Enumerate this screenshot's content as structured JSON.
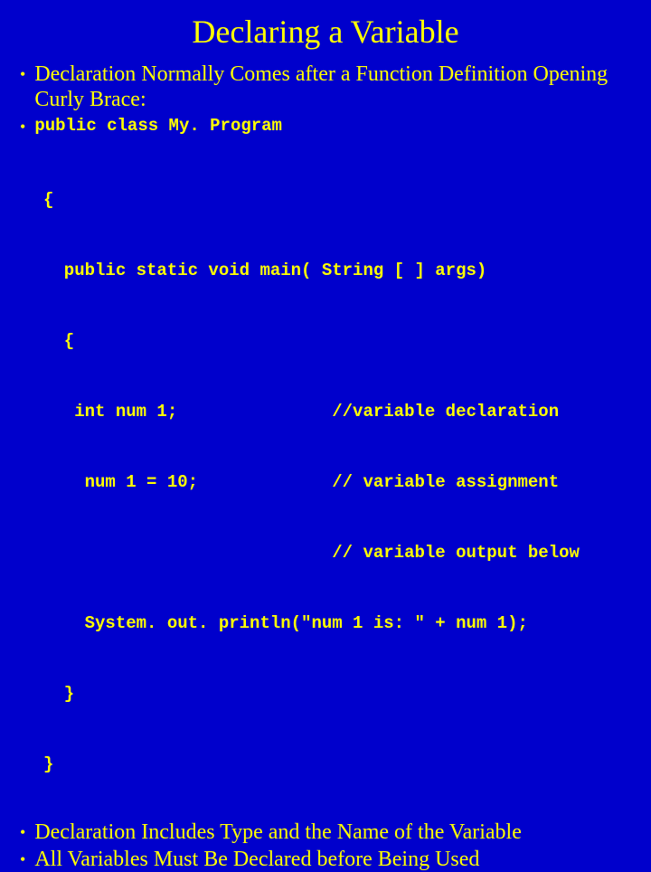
{
  "title": "Declaring a Variable",
  "bullets": {
    "b1": "Declaration Normally Comes after a Function Definition Opening Curly Brace:",
    "b2": "public class My. Program",
    "b3": "Declaration Includes Type and the Name of the Variable",
    "b4": "All Variables Must Be Declared before Being Used"
  },
  "code": {
    "l1": "{",
    "l2": "  public static void main( String [ ] args)",
    "l3": "  {",
    "l4": "   int num 1;               //variable declaration",
    "l5": "    num 1 = 10;             // variable assignment",
    "l6": "                            // variable output below",
    "l7": "    System. out. println(\"num 1 is: \" + num 1);",
    "l8": "  }",
    "l9": "}"
  },
  "dot": "•"
}
